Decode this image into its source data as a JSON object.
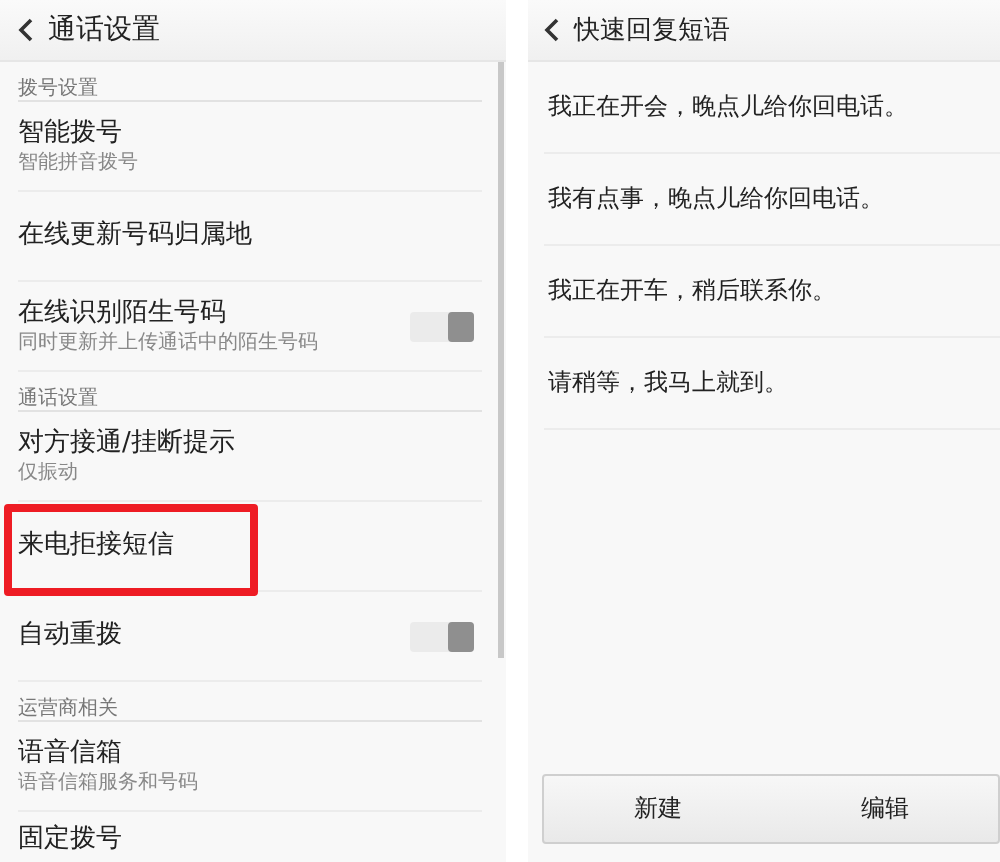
{
  "left_screen": {
    "title": "通话设置",
    "items": [
      {
        "kind": "section",
        "label": "拨号设置"
      },
      {
        "kind": "item",
        "title": "智能拨号",
        "subtitle": "智能拼音拨号",
        "highlighted": false
      },
      {
        "kind": "item",
        "title": "在线更新号码归属地",
        "highlighted": false
      },
      {
        "kind": "toggle",
        "title": "在线识别陌生号码",
        "subtitle": "同时更新并上传通话中的陌生号码",
        "on": true
      },
      {
        "kind": "section",
        "label": "通话设置"
      },
      {
        "kind": "item",
        "title": "对方接通/挂断提示",
        "subtitle": "仅振动",
        "highlighted": false
      },
      {
        "kind": "item",
        "title": "来电拒接短信",
        "highlighted": true
      },
      {
        "kind": "toggle",
        "title": "自动重拨",
        "on": true
      },
      {
        "kind": "section",
        "label": "运营商相关"
      },
      {
        "kind": "item",
        "title": "语音信箱",
        "subtitle": "语音信箱服务和号码",
        "highlighted": false
      },
      {
        "kind": "item",
        "title": "固定拨号",
        "highlighted": false
      }
    ]
  },
  "right_screen": {
    "title": "快速回复短语",
    "replies": [
      "我正在开会，晚点儿给你回电话。",
      "我有点事，晚点儿给你回电话。",
      "我正在开车，稍后联系你。",
      "请稍等，我马上就到。"
    ],
    "buttons": [
      "新建",
      "编辑"
    ]
  }
}
